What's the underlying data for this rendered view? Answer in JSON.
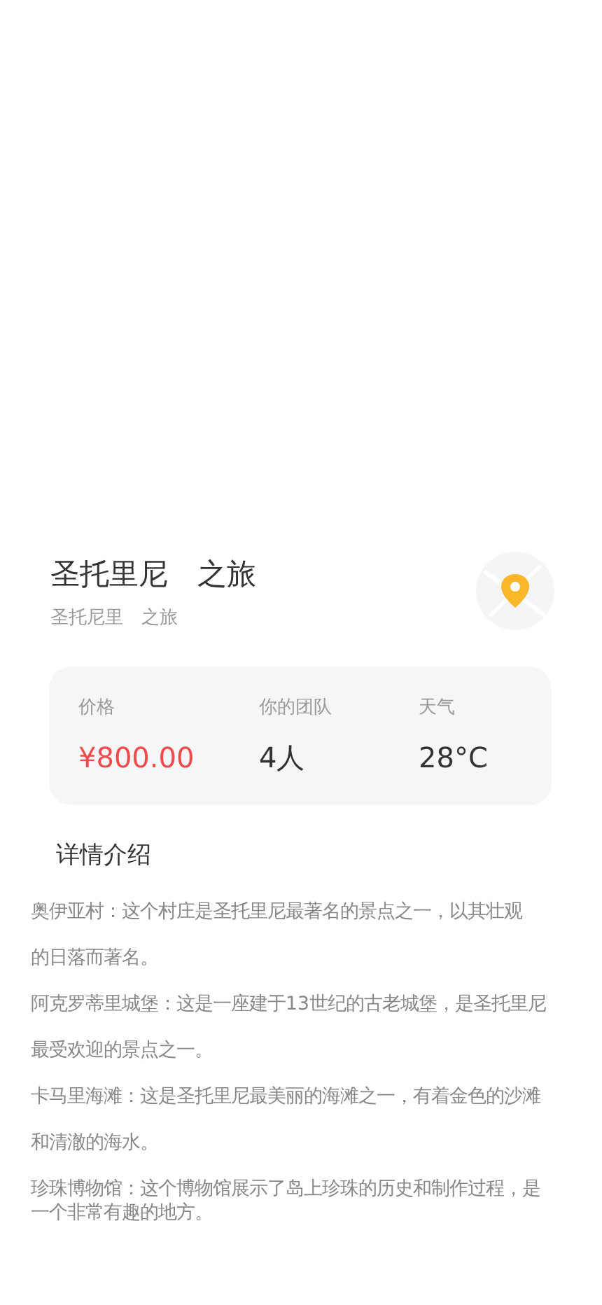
{
  "header": {
    "title": "圣托里尼　之旅",
    "subtitle": "圣托尼里　之旅"
  },
  "stats": [
    {
      "label": "价格",
      "value": "¥800.00",
      "kind": "price"
    },
    {
      "label": "你的团队",
      "value": "4人",
      "kind": "plain"
    },
    {
      "label": "天气",
      "value": "28°C",
      "kind": "plain"
    }
  ],
  "details": {
    "heading": "详情介绍",
    "paragraphs": [
      {
        "kind": "loose",
        "lines": [
          "奥伊亚村：这个村庄是圣托里尼最著名的景点之一，以其壮观",
          "的日落而著名。"
        ]
      },
      {
        "kind": "loose",
        "lines": [
          "阿克罗蒂里城堡：这是一座建于13世纪的古老城堡，是圣托里尼",
          "最受欢迎的景点之一。"
        ]
      },
      {
        "kind": "loose",
        "lines": [
          "卡马里海滩：这是圣托里尼最美丽的海滩之一，有着金色的沙滩",
          "和清澈的海水。"
        ]
      },
      {
        "kind": "tight",
        "lines": [
          "珍珠博物馆：这个博物馆展示了岛上珍珠的历史和制作过程，是",
          "一个非常有趣的地方。"
        ]
      }
    ]
  }
}
